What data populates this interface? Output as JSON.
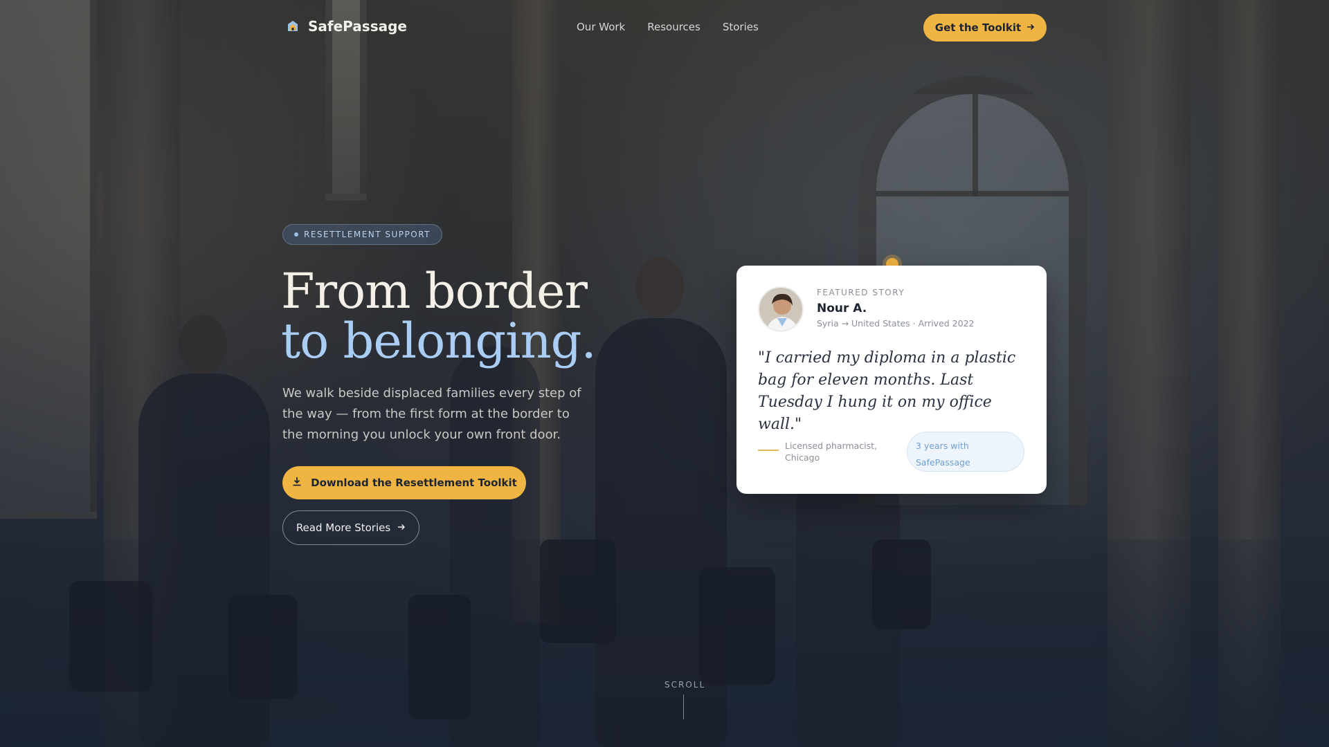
{
  "nav": {
    "brand": "SafePassage",
    "links": [
      "Our Work",
      "Resources",
      "Stories"
    ],
    "cta": "Get the Toolkit"
  },
  "hero": {
    "pill": "RESETTLEMENT SUPPORT",
    "title_line1": "From border",
    "title_line2": "to belonging.",
    "lead": "We walk beside displaced families every step of the way — from the first form at the border to the morning you unlock your own front door.",
    "primary_button": "Download the Resettlement Toolkit",
    "secondary_button": "Read More Stories"
  },
  "card": {
    "eyebrow": "FEATURED STORY",
    "name": "Nour A.",
    "meta": "Syria → United States · Arrived 2022",
    "quote": "\"I carried my diploma in a plastic bag for eleven months. Last Tuesday I hung it on my office wall.\"",
    "role": "Licensed pharmacist, Chicago",
    "tenure": "3 years with SafePassage"
  },
  "scroll": "SCROLL",
  "colors": {
    "accent": "#f0b442",
    "highlight": "#a9cdf4",
    "background": "#1f2a3a"
  },
  "icons": {
    "brand": "shield-home-icon",
    "arrow": "arrow-right-icon",
    "download": "download-icon"
  }
}
